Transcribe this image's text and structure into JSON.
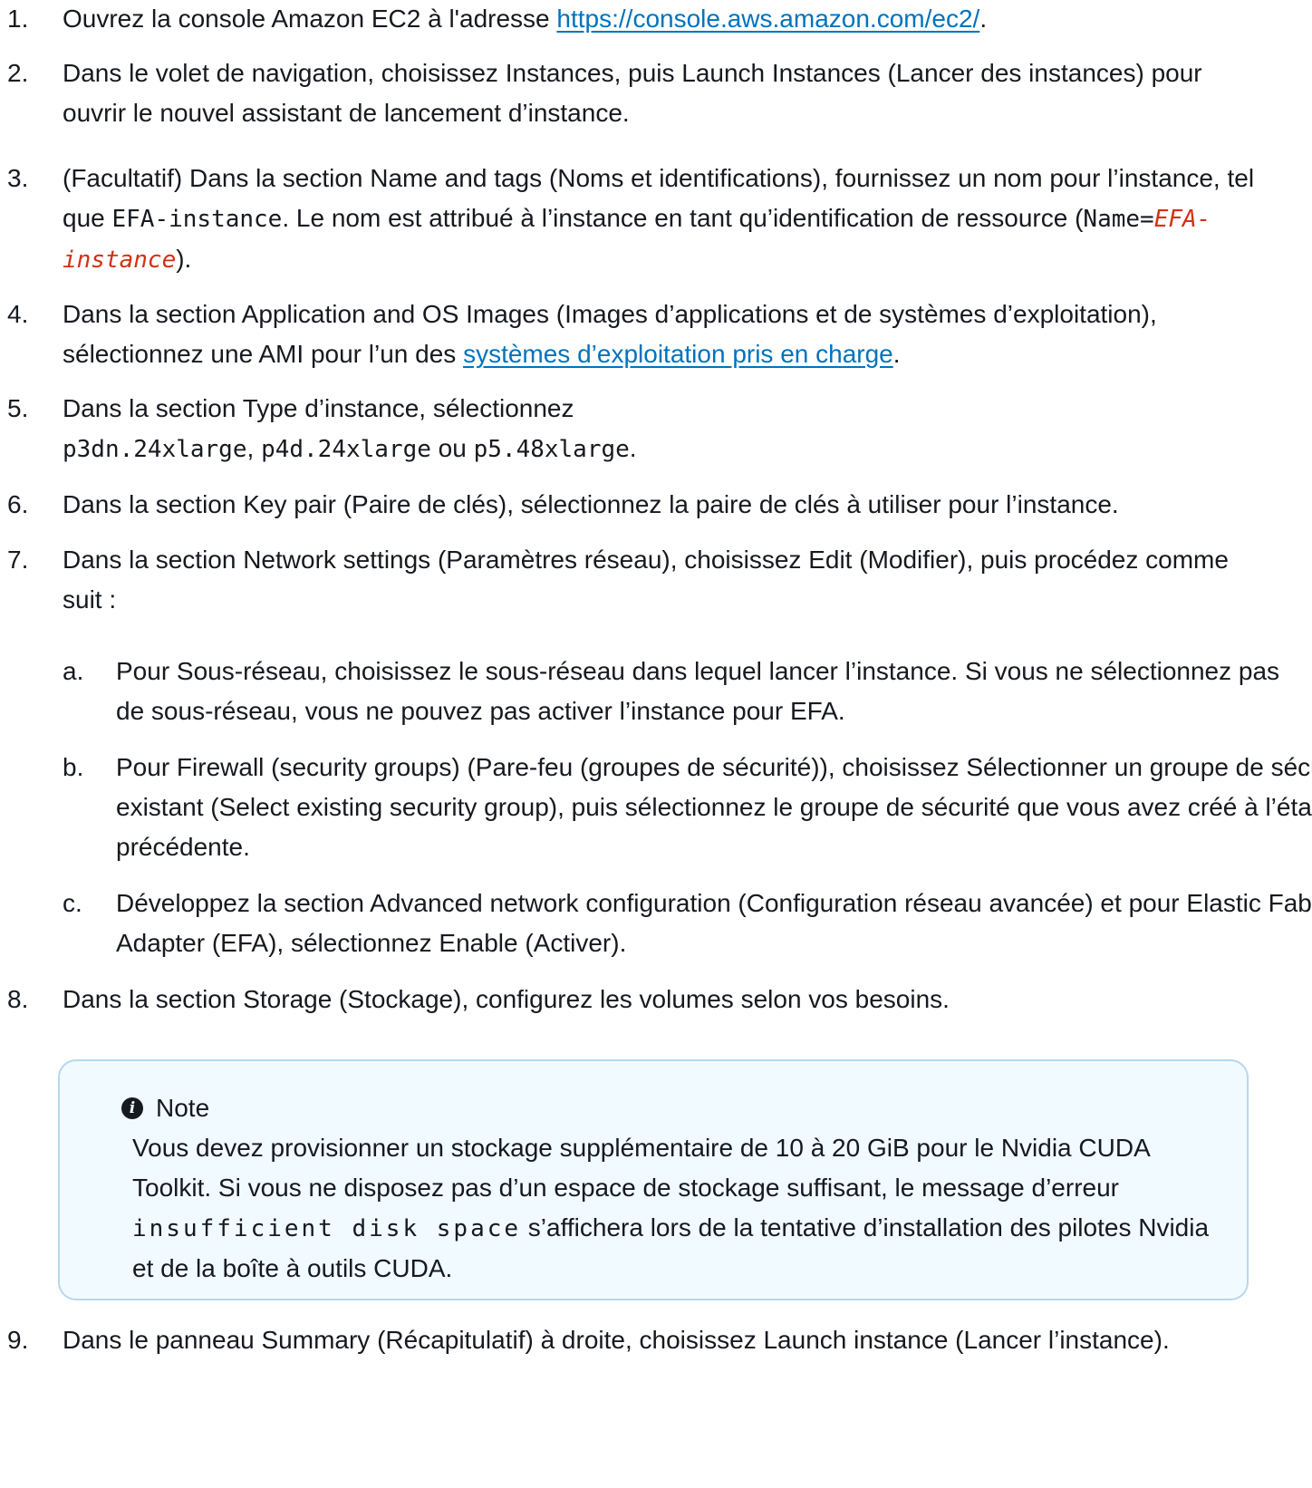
{
  "steps": [
    {
      "num": "1.",
      "text": "Ouvrez la console Amazon EC2 à l'adresse ",
      "link": "https://console.aws.amazon.com/ec2/",
      "tail": "."
    },
    {
      "num": "2.",
      "text": "Dans le volet de navigation, choisissez Instances, puis Launch Instances (Lancer des instances) pour ouvrir le nouvel assistant de lancement d’instance."
    },
    {
      "num": "3.",
      "t1": "(Facultatif) Dans la section Name and tags (Noms et identifications), fournissez un nom pour l’instance, tel que ",
      "code1": "EFA-instance",
      "t2": ". Le nom est attribué à l’instance en tant qu’identification de ressource (",
      "code2": "Name=",
      "code3": "EFA-instance",
      "t3": ")."
    },
    {
      "num": "4.",
      "text": "Dans la section Application and OS Images (Images d’applications et de systèmes d’exploitation), sélectionnez une AMI pour l’un des ",
      "link": "systèmes d’exploitation pris en charge",
      "tail": "."
    },
    {
      "num": "5.",
      "text": "Dans la section Type d’instance, sélectionnez",
      "code1": "p3dn.24xlarge",
      "sep1": ", ",
      "code2": "p4d.24xlarge",
      "sep2": " ou ",
      "code3": "p5.48xlarge",
      "tail": "."
    },
    {
      "num": "6.",
      "text": "Dans la section Key pair (Paire de clés), sélectionnez la paire de clés à utiliser pour l’instance."
    },
    {
      "num": "7.",
      "text": "Dans la section Network settings (Paramètres réseau), choisissez Edit (Modifier), puis procédez comme suit :"
    },
    {
      "num": "8.",
      "text": "Dans la section Storage (Stockage), configurez les volumes selon vos besoins."
    },
    {
      "num": "9.",
      "text": "Dans le panneau Summary (Récapitulatif) à droite, choisissez Launch instance (Lancer l’instance)."
    }
  ],
  "substeps": [
    {
      "num": "a.",
      "text": "Pour Sous-réseau, choisissez le sous-réseau dans lequel lancer l’instance. Si vous ne sélectionnez pas de sous-réseau, vous ne pouvez pas activer l’instance pour EFA."
    },
    {
      "num": "b.",
      "text": "Pour Firewall (security groups) (Pare-feu (groupes de sécurité)), choisissez Sélectionner un groupe de sécurité existant (Select existing security group), puis sélectionnez le groupe de sécurité que vous avez créé à l’étape précédente."
    },
    {
      "num": "c.",
      "text": "Développez la section Advanced network configuration (Configuration réseau avancée) et pour Elastic Fabric Adapter (EFA), sélectionnez Enable (Activer)."
    }
  ],
  "note": {
    "title": "Note",
    "icon": "info-icon",
    "t1": "Vous devez provisionner un stockage supplémentaire de 10 à 20 GiB pour le Nvidia CUDA Toolkit. Si vous ne disposez pas d’un espace de stockage suffisant, le message d’erreur ",
    "code": "insufficient disk space",
    "t2": " s’affichera lors de la tentative d’installation des pilotes Nvidia et de la boîte à outils CUDA."
  }
}
